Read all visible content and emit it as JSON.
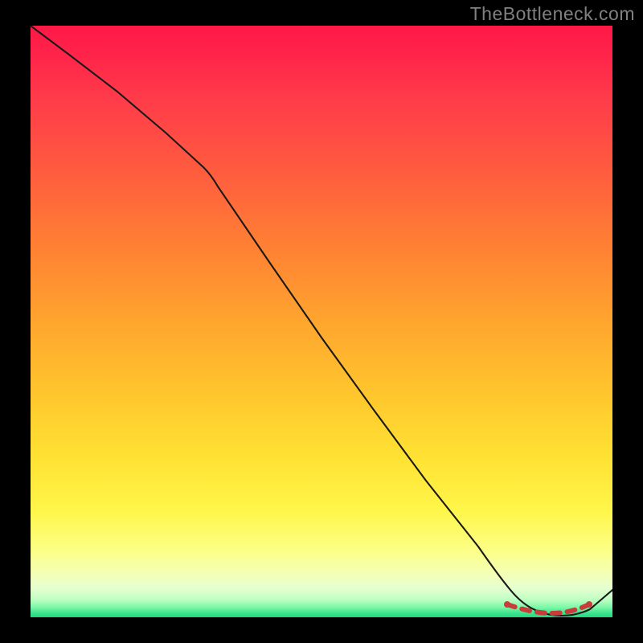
{
  "watermark": "TheBottleneck.com",
  "chart_data": {
    "type": "line",
    "title": "",
    "xlabel": "",
    "ylabel": "",
    "xlim": [
      0,
      100
    ],
    "ylim": [
      0,
      100
    ],
    "grid": false,
    "legend": false,
    "series": [
      {
        "name": "curve",
        "x": [
          0,
          8,
          16,
          24,
          32,
          40,
          48,
          56,
          64,
          72,
          80,
          84,
          88,
          92,
          96,
          100
        ],
        "y": [
          100,
          94,
          87,
          80,
          72,
          58,
          46,
          34,
          22,
          11,
          3,
          1,
          0,
          0,
          2,
          6
        ]
      }
    ],
    "highlight_range_x": [
      82,
      96
    ],
    "colors": {
      "curve": "#1a1a1a",
      "highlight": "#c83c3c",
      "gradient_top": "#ff1846",
      "gradient_bottom": "#1dd87e"
    }
  }
}
